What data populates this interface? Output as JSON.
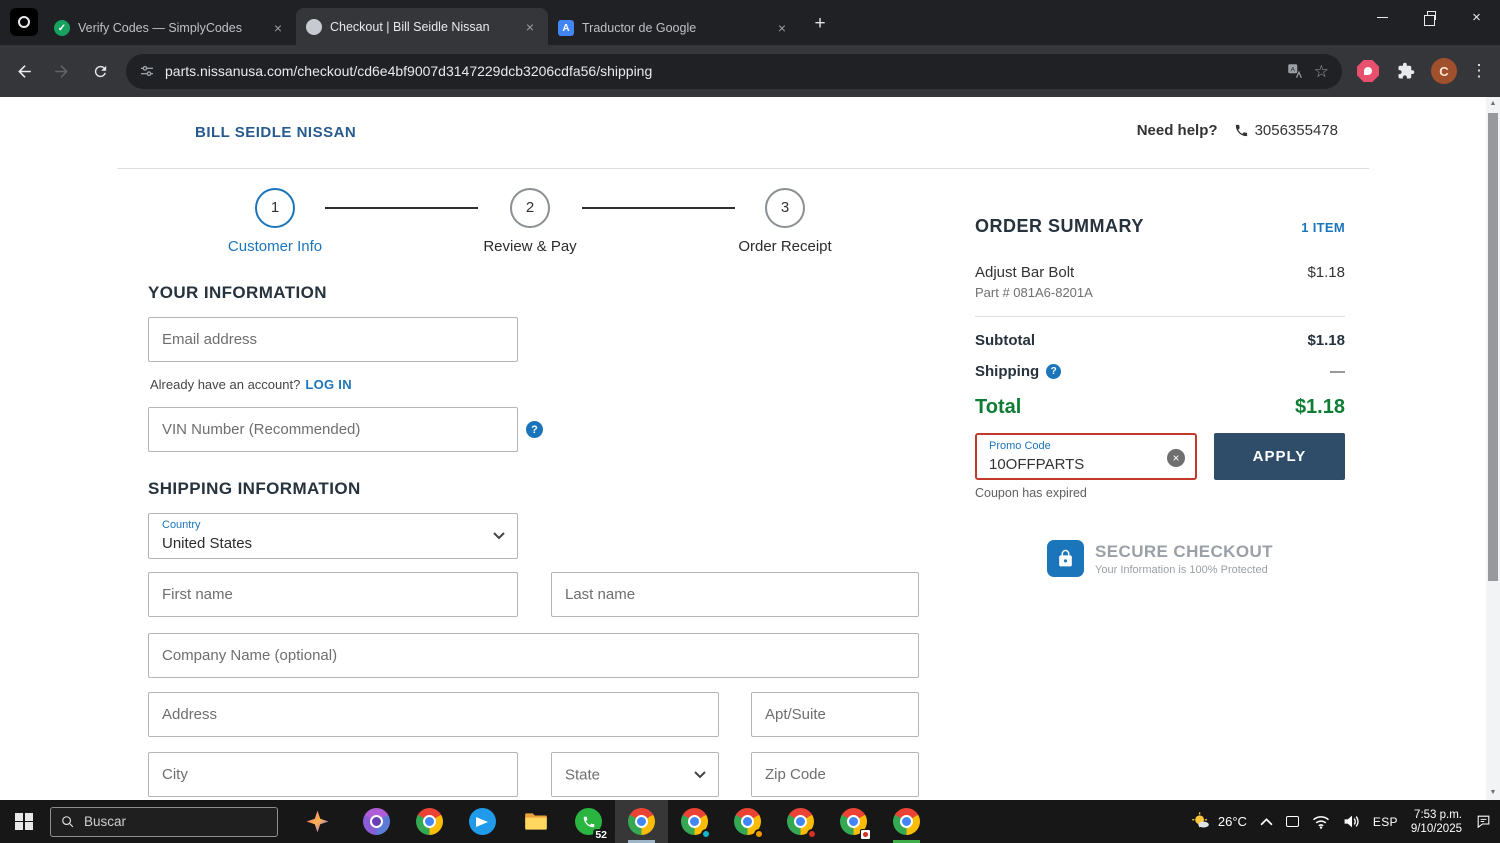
{
  "browser": {
    "tabs": [
      {
        "title": "Verify Codes — SimplyCodes"
      },
      {
        "title": "Checkout | Bill Seidle Nissan"
      },
      {
        "title": "Traductor de Google"
      }
    ],
    "url": "parts.nissanusa.com/checkout/cd6e4bf9007d3147229dcb3206cdfa56/shipping"
  },
  "site": {
    "dealer_name": "BILL SEIDLE NISSAN",
    "need_help": "Need help?",
    "phone": "3056355478"
  },
  "stepper": {
    "steps": [
      {
        "number": "1",
        "label": "Customer Info"
      },
      {
        "number": "2",
        "label": "Review & Pay"
      },
      {
        "number": "3",
        "label": "Order Receipt"
      }
    ]
  },
  "customer": {
    "section_title": "YOUR INFORMATION",
    "email_placeholder": "Email address",
    "account_prompt": "Already have an account?",
    "login_link": "LOG IN",
    "vin_placeholder": "VIN Number (Recommended)"
  },
  "shipping_form": {
    "section_title": "SHIPPING INFORMATION",
    "country_label": "Country",
    "country_value": "United States",
    "first_name_placeholder": "First name",
    "last_name_placeholder": "Last name",
    "company_placeholder": "Company Name (optional)",
    "address_placeholder": "Address",
    "apt_placeholder": "Apt/Suite",
    "city_placeholder": "City",
    "state_placeholder": "State",
    "zip_placeholder": "Zip Code"
  },
  "order_summary": {
    "title": "ORDER SUMMARY",
    "item_count": "1 ITEM",
    "item_name": "Adjust Bar Bolt",
    "item_price": "$1.18",
    "part_number": "Part # 081A6-8201A",
    "subtotal_label": "Subtotal",
    "subtotal_value": "$1.18",
    "shipping_label": "Shipping",
    "shipping_value": "—",
    "total_label": "Total",
    "total_value": "$1.18",
    "promo_label": "Promo Code",
    "promo_value": "10OFFPARTS",
    "apply_button": "APPLY",
    "promo_error": "Coupon has expired",
    "secure_title": "SECURE CHECKOUT",
    "secure_subtitle": "Your Information is 100% Protected"
  },
  "taskbar": {
    "search_placeholder": "Buscar",
    "whatsapp_badge": "52",
    "temperature": "26°C",
    "language": "ESP",
    "time": "7:53 p.m.",
    "date": "9/10/2025"
  },
  "icons": {
    "check_glyph": "✓",
    "close_glyph": "×",
    "new_tab_glyph": "+",
    "kebab_glyph": "⋮",
    "star_glyph": "☆",
    "question_glyph": "?",
    "avatar_initial": "C",
    "translate_letter": "A",
    "scroll_up": "▲",
    "scroll_down": "▼"
  },
  "colors": {
    "accent_blue": "#1b75bb",
    "total_green": "#0e7d33",
    "error_red": "#c0392b",
    "apply_navy": "#2f4d68"
  }
}
